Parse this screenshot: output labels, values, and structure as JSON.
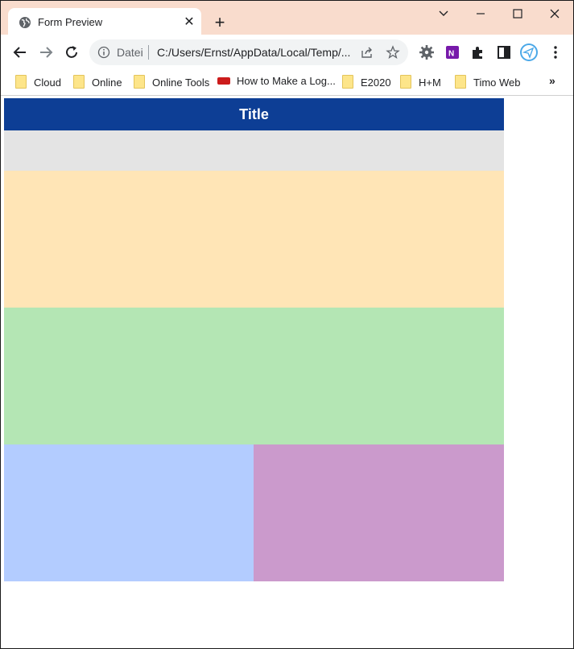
{
  "browser": {
    "tab": {
      "title": "Form Preview",
      "close": "✕"
    },
    "new_tab": "+",
    "window_controls": {
      "chevron": "chevron-down",
      "minimize": "minimize",
      "maximize": "maximize",
      "close": "close"
    },
    "omnibox": {
      "scheme_label": "Datei",
      "url": "C:/Users/Ernst/AppData/Local/Temp/..."
    },
    "bookmarks": [
      {
        "label": "Cloud",
        "icon": "folder-icon"
      },
      {
        "label": "Online",
        "icon": "folder-icon"
      },
      {
        "label": "Online Tools",
        "icon": "folder-icon"
      },
      {
        "label": "How to Make a Log...",
        "icon": "hdd-icon"
      },
      {
        "label": "E2020",
        "icon": "folder-icon"
      },
      {
        "label": "H+M",
        "icon": "folder-icon"
      },
      {
        "label": "Timo Web",
        "icon": "folder-icon"
      }
    ],
    "bookmarks_more": "»",
    "accent_colors": {
      "tabstrip": "#f9dccd"
    }
  },
  "form": {
    "title": "Title",
    "colors": {
      "title_bar": "#0d3e95",
      "grey": "#e4e4e4",
      "peach": "#ffe5b6",
      "green": "#b4e6b4",
      "blue": "#b3ccff",
      "purple": "#cb9acc"
    }
  }
}
